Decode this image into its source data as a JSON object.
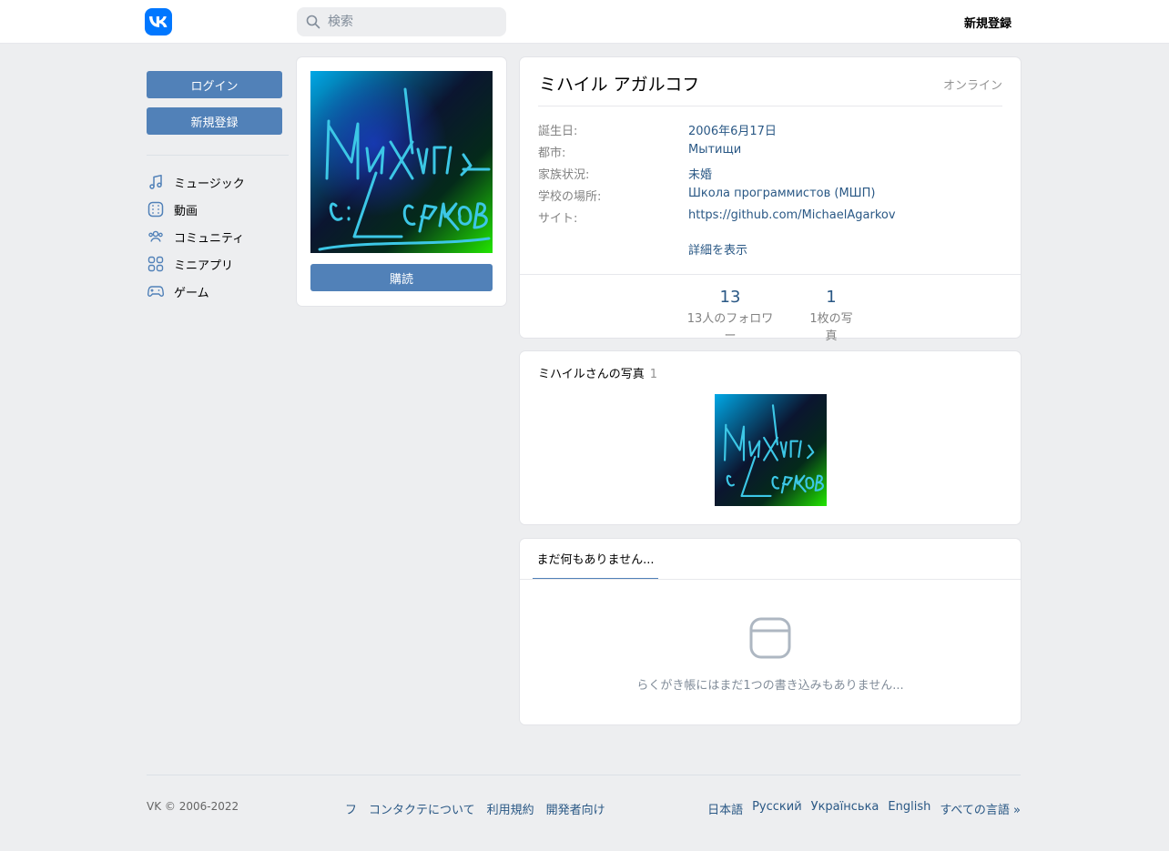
{
  "header": {
    "search_placeholder": "検索",
    "register_label": "新規登録"
  },
  "sidebar": {
    "login_label": "ログイン",
    "register_label": "新規登録",
    "items": [
      {
        "label": "ミュージック",
        "icon": "music-icon"
      },
      {
        "label": "動画",
        "icon": "video-icon"
      },
      {
        "label": "コミュニティ",
        "icon": "community-icon"
      },
      {
        "label": "ミニアプリ",
        "icon": "mini-apps-icon"
      },
      {
        "label": "ゲーム",
        "icon": "gamepad-icon"
      }
    ]
  },
  "avatar": {
    "subscribe_label": "購読"
  },
  "profile": {
    "name": "ミハイル アガルコフ",
    "status": "オンライン",
    "info": [
      {
        "label": "誕生日:",
        "value": "2006年6月17日"
      },
      {
        "label": "都市:",
        "value": "Мытищи"
      },
      {
        "label": "家族状況:",
        "value": "未婚"
      },
      {
        "label": "学校の場所:",
        "value": "Школа программистов (МШП)"
      },
      {
        "label": "サイト:",
        "value": "https://github.com/MichaelAgarkov"
      }
    ],
    "more_label": "詳細を表示",
    "stats": [
      {
        "num": "13",
        "label": "13人のフォロワー"
      },
      {
        "num": "1",
        "label": "1枚の写真"
      }
    ]
  },
  "photos": {
    "title": "ミハイルさんの写真",
    "count": "1"
  },
  "wall": {
    "tab_label": "まだ何もありません...",
    "empty_text": "らくがき帳にはまだ1つの書き込みもありません..."
  },
  "footer": {
    "copyright": "VK © 2006-2022",
    "links": [
      "フ",
      "コンタクテについて",
      "利用規約",
      "開発者向け"
    ],
    "languages": [
      "日本語",
      "Русский",
      "Українська",
      "English",
      "すべての言語 »"
    ]
  },
  "colors": {
    "accent": "#5181b8",
    "link": "#2a5885",
    "brand": "#0077ff",
    "background": "#edeef0"
  }
}
